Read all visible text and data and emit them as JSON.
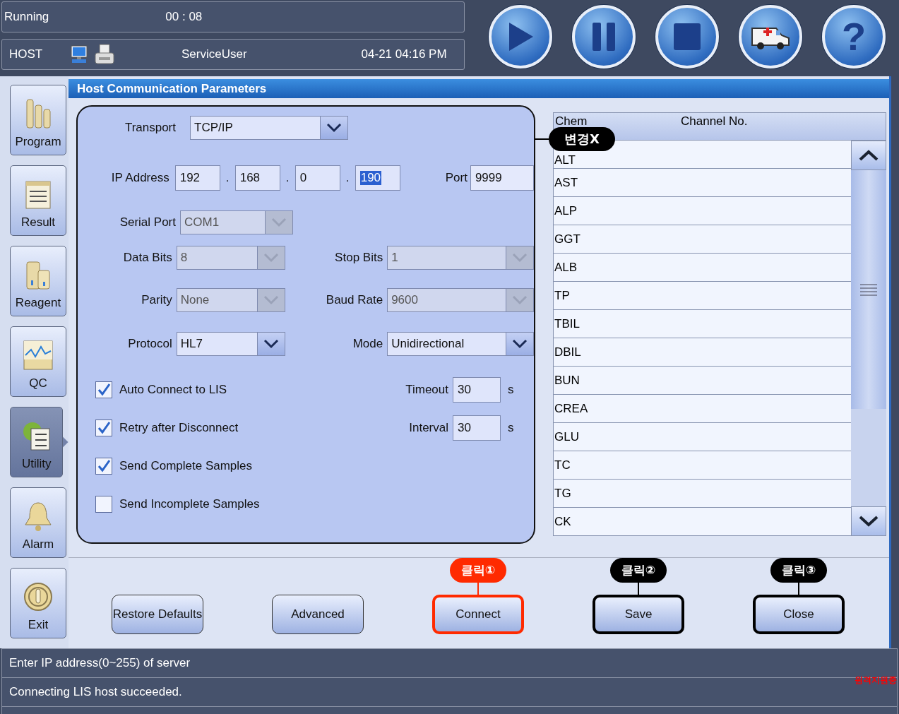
{
  "header": {
    "status": "Running",
    "timer": "00 : 08",
    "connection": "HOST",
    "user": "ServiceUser",
    "datetime": "04-21 04:16 PM"
  },
  "toolbar": [
    {
      "kind": "play"
    },
    {
      "kind": "pause"
    },
    {
      "kind": "stop"
    },
    {
      "kind": "ambulance"
    },
    {
      "kind": "help",
      "label": "?"
    }
  ],
  "sidebar": [
    {
      "kind": "program",
      "label": "Program",
      "selected": false
    },
    {
      "kind": "result",
      "label": "Result",
      "selected": false
    },
    {
      "kind": "reagent",
      "label": "Reagent",
      "selected": false
    },
    {
      "kind": "qc",
      "label": "QC",
      "selected": false
    },
    {
      "kind": "utility",
      "label": "Utility",
      "selected": true
    },
    {
      "kind": "alarm",
      "label": "Alarm",
      "selected": false
    },
    {
      "kind": "exit",
      "label": "Exit",
      "selected": false
    }
  ],
  "panel_title": "Host Communication Parameters",
  "transport": {
    "label": "Transport",
    "value": "TCP/IP"
  },
  "ip_address": {
    "label": "IP Address",
    "octets": [
      {
        "value": "192",
        "highlighted": false
      },
      {
        "value": "168",
        "highlighted": false
      },
      {
        "value": "0",
        "highlighted": false
      },
      {
        "value": "190",
        "highlighted": true
      }
    ],
    "separator": "."
  },
  "port": {
    "label": "Port",
    "value": "9999"
  },
  "dropdown_rows": [
    [
      {
        "label": "Serial Port",
        "value": "COM1",
        "disabled": true
      }
    ],
    [
      {
        "label": "Data Bits",
        "value": "8",
        "disabled": true
      },
      {
        "label": "Stop Bits",
        "value": "1",
        "disabled": true
      }
    ],
    [
      {
        "label": "Parity",
        "value": "None",
        "disabled": true
      },
      {
        "label": "Baud Rate",
        "value": "9600",
        "disabled": true
      }
    ],
    [
      {
        "label": "Protocol",
        "value": "HL7",
        "disabled": false
      },
      {
        "label": "Mode",
        "value": "Unidirectional",
        "disabled": false
      }
    ]
  ],
  "checkboxes": [
    {
      "label": "Auto Connect to LIS",
      "checked": true
    },
    {
      "label": "Retry after Disconnect",
      "checked": true
    },
    {
      "label": "Send Complete Samples",
      "checked": true
    },
    {
      "label": "Send Incomplete Samples",
      "checked": false
    }
  ],
  "timing_fields": [
    {
      "label": "Timeout",
      "value": "30",
      "unit": "s"
    },
    {
      "label": "Interval",
      "value": "30",
      "unit": "s"
    }
  ],
  "table": {
    "columns": [
      "Chem",
      "Channel No."
    ],
    "rows": [
      "ALT",
      "AST",
      "ALP",
      "GGT",
      "ALB",
      "TP",
      "TBIL",
      "DBIL",
      "BUN",
      "CREA",
      "GLU",
      "TC",
      "TG",
      "CK"
    ]
  },
  "annotation": {
    "text": "변경X"
  },
  "buttons": [
    {
      "label": "Restore Defaults"
    },
    {
      "label": "Advanced"
    },
    {
      "label": "Connect",
      "callout": {
        "text": "클릭①",
        "color": "#ff2a00"
      }
    },
    {
      "label": "Save",
      "callout": {
        "text": "클릭②",
        "color": "#000000"
      }
    },
    {
      "label": "Close",
      "callout": {
        "text": "클릭③",
        "color": "#000000"
      }
    }
  ],
  "status_lines": [
    "Enter IP address(0~255) of server",
    "Connecting LIS host succeeded."
  ],
  "remote_indicator": "원격지원중"
}
